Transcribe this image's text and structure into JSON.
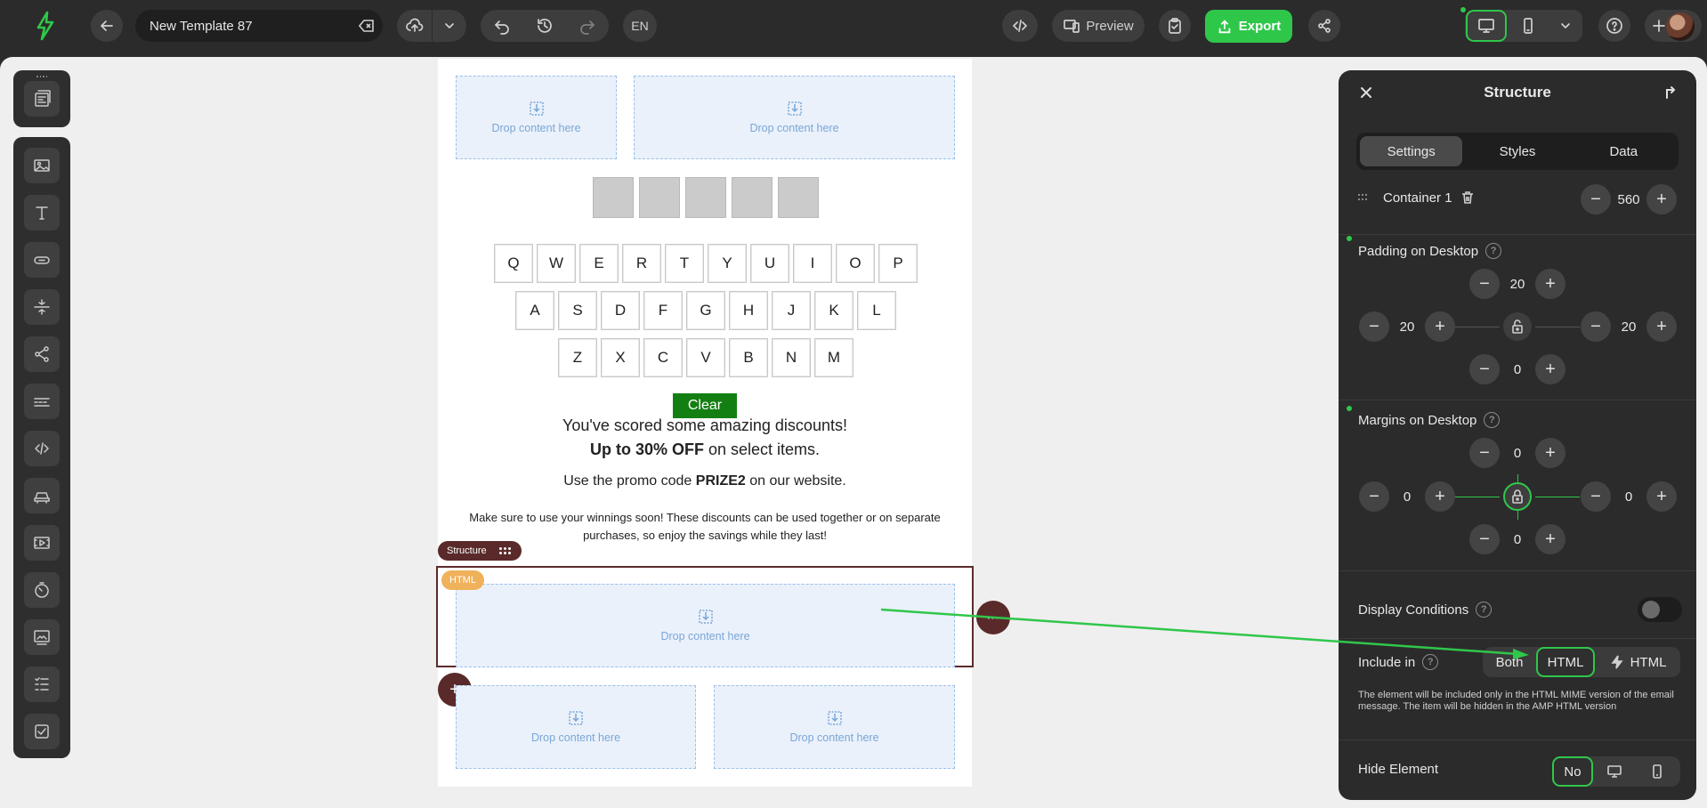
{
  "topbar": {
    "template_name": "New Template 87",
    "language": "EN",
    "preview_label": "Preview",
    "export_label": "Export"
  },
  "canvas": {
    "drop_text": "Drop content here",
    "keys_row1": [
      "Q",
      "W",
      "E",
      "R",
      "T",
      "Y",
      "U",
      "I",
      "O",
      "P"
    ],
    "keys_row2": [
      "A",
      "S",
      "D",
      "F",
      "G",
      "H",
      "J",
      "K",
      "L"
    ],
    "keys_row3": [
      "Z",
      "X",
      "C",
      "V",
      "B",
      "N",
      "M"
    ],
    "clear_label": "Clear",
    "line1": "You've scored some amazing discounts!",
    "line2_bold": "Up to 30% OFF",
    "line2_rest": " on select items.",
    "line3_pre": "Use the promo code ",
    "line3_code": "PRIZE2",
    "line3_post": " on our website.",
    "line4": "Make sure to use your winnings soon! These discounts can be used together or on separate purchases, so enjoy the savings while they last!",
    "structure_pill": "Structure",
    "html_pill": "HTML"
  },
  "panel": {
    "title": "Structure",
    "tabs": [
      "Settings",
      "Styles",
      "Data"
    ],
    "container_label": "Container 1",
    "container_width": "560",
    "padding_label": "Padding on Desktop",
    "padding": {
      "top": "20",
      "left": "20",
      "right": "20",
      "bottom": "0"
    },
    "margins_label": "Margins on Desktop",
    "margins": {
      "top": "0",
      "left": "0",
      "right": "0",
      "bottom": "0"
    },
    "display_conditions_label": "Display Conditions",
    "include_in_label": "Include in",
    "include_options": [
      "Both",
      "HTML",
      "HTML"
    ],
    "include_note": "The element will be included only in the HTML MIME version of the email message. The item will be hidden in the AMP HTML version",
    "hide_element_label": "Hide Element",
    "hide_no": "No"
  },
  "colors": {
    "accent_green": "#2fc74a",
    "structure_brown": "#5a2a2a",
    "clear_green": "#137f13",
    "html_orange": "#f0b15b"
  }
}
